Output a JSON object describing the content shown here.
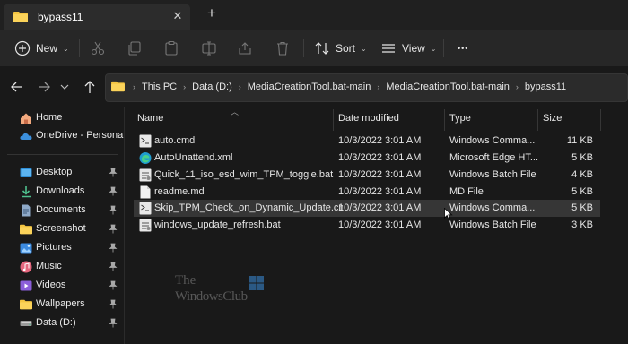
{
  "tab": {
    "title": "bypass11",
    "close_glyph": "✕",
    "new_tab_glyph": "+"
  },
  "toolbar": {
    "new_label": "New",
    "sort_label": "Sort",
    "view_label": "View",
    "more_glyph": "•••",
    "chevron": "⌄"
  },
  "address": {
    "crumbs": [
      "This PC",
      "Data (D:)",
      "MediaCreationTool.bat-main",
      "MediaCreationTool.bat-main",
      "bypass11"
    ],
    "separator": "›"
  },
  "sidebar": {
    "items": [
      {
        "label": "Home",
        "icon": "home-icon",
        "pinned": false
      },
      {
        "label": "OneDrive - Personal",
        "icon": "onedrive-icon",
        "pinned": false
      },
      {
        "label": "Desktop",
        "icon": "desktop-icon",
        "pinned": true
      },
      {
        "label": "Downloads",
        "icon": "downloads-icon",
        "pinned": true
      },
      {
        "label": "Documents",
        "icon": "documents-icon",
        "pinned": true
      },
      {
        "label": "Screenshot",
        "icon": "folder-icon",
        "pinned": true
      },
      {
        "label": "Pictures",
        "icon": "pictures-icon",
        "pinned": true
      },
      {
        "label": "Music",
        "icon": "music-icon",
        "pinned": true
      },
      {
        "label": "Videos",
        "icon": "videos-icon",
        "pinned": true
      },
      {
        "label": "Wallpapers",
        "icon": "folder-icon",
        "pinned": true
      },
      {
        "label": "Data (D:)",
        "icon": "drive-icon",
        "pinned": true
      }
    ]
  },
  "columns": {
    "name": "Name",
    "date": "Date modified",
    "type": "Type",
    "size": "Size"
  },
  "files": [
    {
      "name": "auto.cmd",
      "date": "10/3/2022 3:01 AM",
      "type": "Windows Comma...",
      "size": "11 KB",
      "icon": "cmd-file-icon"
    },
    {
      "name": "AutoUnattend.xml",
      "date": "10/3/2022 3:01 AM",
      "type": "Microsoft Edge HT...",
      "size": "5 KB",
      "icon": "edge-icon"
    },
    {
      "name": "Quick_11_iso_esd_wim_TPM_toggle.bat",
      "date": "10/3/2022 3:01 AM",
      "type": "Windows Batch File",
      "size": "4 KB",
      "icon": "bat-file-icon"
    },
    {
      "name": "readme.md",
      "date": "10/3/2022 3:01 AM",
      "type": "MD File",
      "size": "5 KB",
      "icon": "text-file-icon"
    },
    {
      "name": "Skip_TPM_Check_on_Dynamic_Update.cmd",
      "date": "10/3/2022 3:01 AM",
      "type": "Windows Comma...",
      "size": "5 KB",
      "icon": "cmd-file-icon",
      "selected": true
    },
    {
      "name": "windows_update_refresh.bat",
      "date": "10/3/2022 3:01 AM",
      "type": "Windows Batch File",
      "size": "3 KB",
      "icon": "bat-file-icon"
    }
  ],
  "watermark": {
    "line1": "The",
    "line2": "WindowsClub"
  },
  "colors": {
    "folder": "#f4c542",
    "accent": "#3b8fdc",
    "selected_row": "#363636",
    "background": "#191919"
  }
}
